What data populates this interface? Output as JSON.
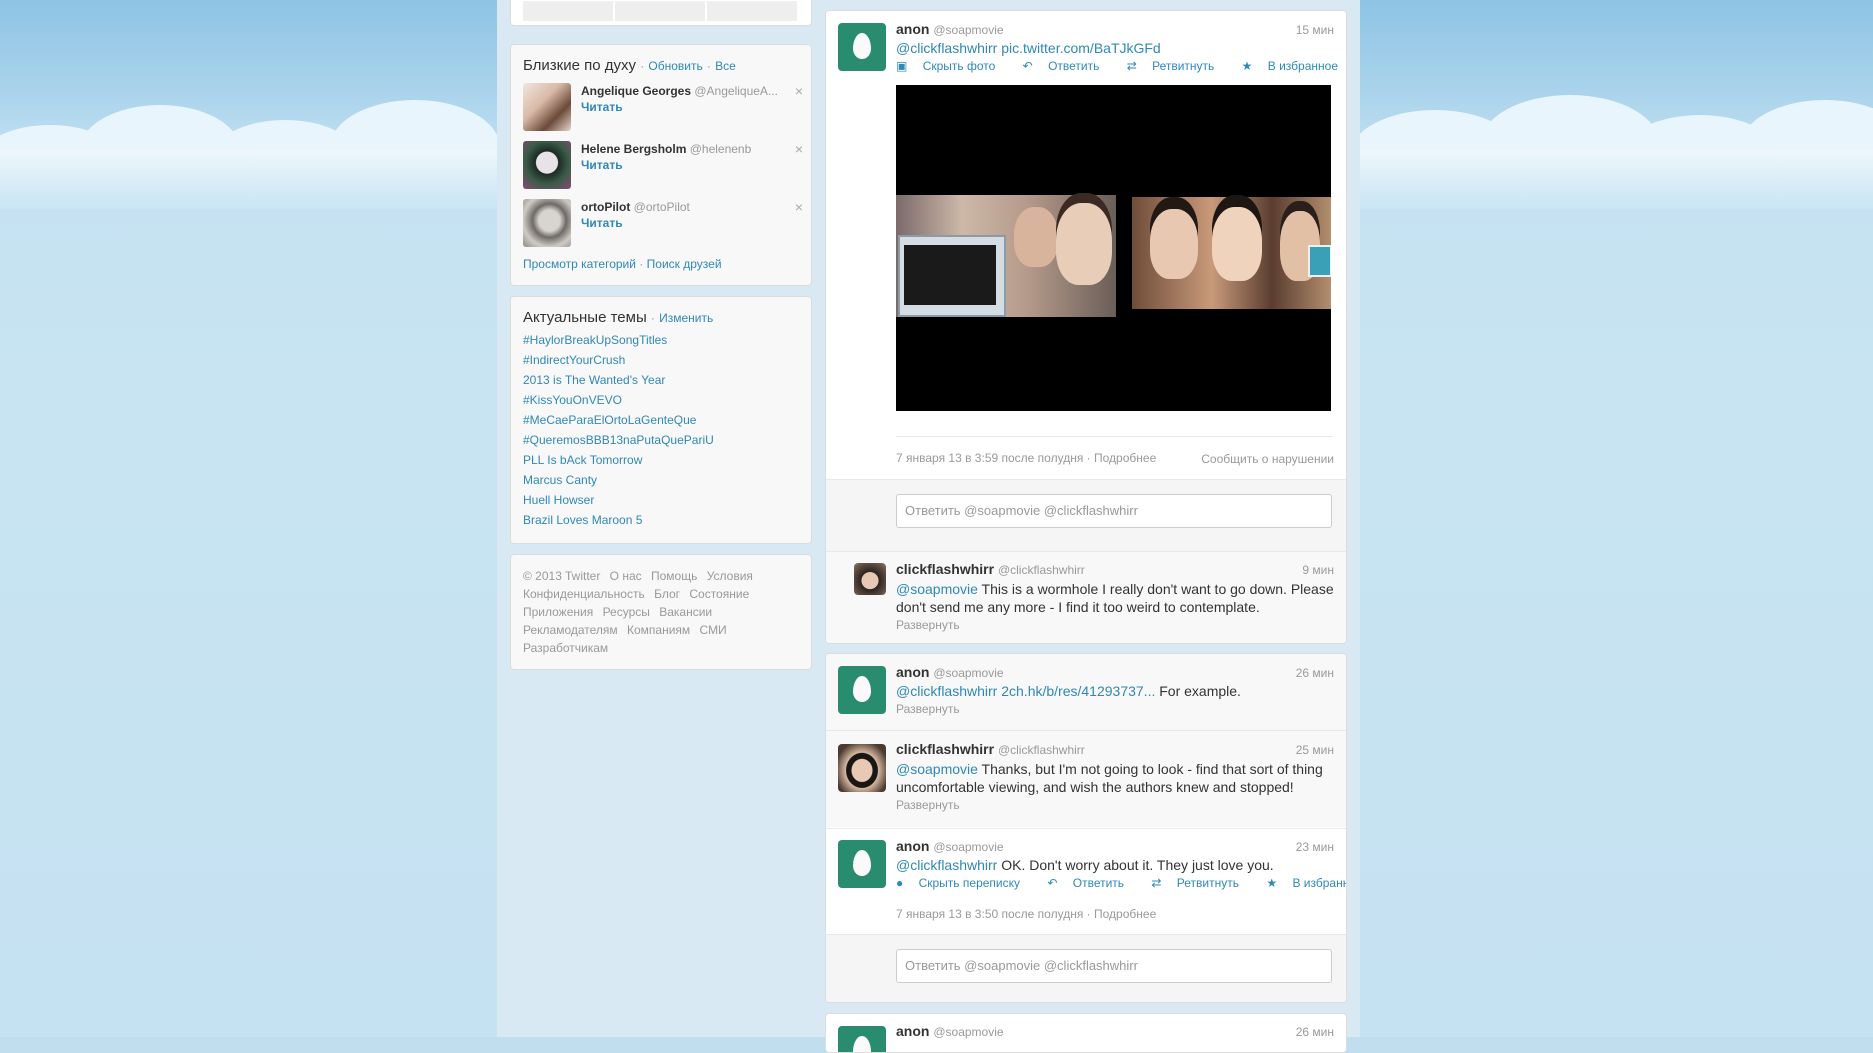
{
  "left": {
    "who_to_follow": {
      "title": "Близкие по духу",
      "refresh": "Обновить",
      "all": "Все",
      "sep": "·",
      "items": [
        {
          "name": "Angelique Georges",
          "handle": "@AngeliqueA...",
          "follow": "Читать"
        },
        {
          "name": "Helene Bergsholm",
          "handle": "@helenenb",
          "follow": "Читать"
        },
        {
          "name": "ortoPilot",
          "handle": "@ortoPilot",
          "follow": "Читать"
        }
      ],
      "close": "×",
      "browse": "Просмотр категорий",
      "find_friends": "Поиск друзей"
    },
    "trends": {
      "title": "Актуальные темы",
      "change": "Изменить",
      "items": [
        "#HaylorBreakUpSongTitles",
        "#IndirectYourCrush",
        "2013 is The Wanted's Year",
        "#KissYouOnVEVO",
        "#MeCaeParaElOrtoLaGenteQue",
        "#QueremosBBB13naPutaQuePariU",
        "PLL Is bAck Tomorrow",
        "Marcus Canty",
        "Huell Howser",
        "Brazil Loves Maroon 5"
      ]
    },
    "footer": {
      "links": [
        "© 2013 Twitter",
        "О нас",
        "Помощь",
        "Условия",
        "Конфиденциальность",
        "Блог",
        "Состояние",
        "Приложения",
        "Ресурсы",
        "Вакансии",
        "Рекламодателям",
        "Компаниям",
        "СМИ",
        "Разработчикам"
      ]
    }
  },
  "timeline": {
    "tweet1": {
      "name": "anon",
      "handle": "@soapmovie",
      "time": "15 мин",
      "mention": "@clickflashwhirr",
      "link": "pic.twitter.com/BaTJkGFd",
      "actions": {
        "hide_photo": "Скрыть фото",
        "reply": "Ответить",
        "retweet": "Ретвитнуть",
        "favorite": "В избранное"
      },
      "date": "7 января 13 в 3:59 после полудня",
      "details": "Подробнее",
      "report": "Сообщить о нарушении",
      "reply_placeholder": "Ответить @soapmovie @clickflashwhirr"
    },
    "reply1": {
      "name": "clickflashwhirr",
      "handle": "@clickflashwhirr",
      "time": "9 мин",
      "mention": "@soapmovie",
      "text": " This is a wormhole I really don't want to go down. Please don't send me any more - I find it too weird to contemplate.",
      "expand": "Развернуть"
    },
    "tweet2": {
      "name": "anon",
      "handle": "@soapmovie",
      "time": "26 мин",
      "mention": "@clickflashwhirr",
      "link": "2ch.hk/b/res/41293737...",
      "text": " For example.",
      "expand": "Развернуть"
    },
    "tweet3": {
      "name": "clickflashwhirr",
      "handle": "@clickflashwhirr",
      "time": "25 мин",
      "mention": "@soapmovie",
      "text": " Thanks, but I'm not going to look - find that sort of thing uncomfortable viewing, and wish the authors knew and stopped!",
      "expand": "Развернуть"
    },
    "tweet4": {
      "name": "anon",
      "handle": "@soapmovie",
      "time": "23 мин",
      "mention": "@clickflashwhirr",
      "text": " OK. Don't worry about it. They just love you.",
      "actions": {
        "hide_convo": "Скрыть переписку",
        "reply": "Ответить",
        "retweet": "Ретвитнуть",
        "favorite": "В избранное"
      },
      "date": "7 января 13 в 3:50 после полудня",
      "details": "Подробнее",
      "reply_placeholder": "Ответить @soapmovie @clickflashwhirr"
    },
    "tweet5": {
      "name": "anon",
      "handle": "@soapmovie",
      "time": "26 мин"
    }
  },
  "colors": {
    "link": "#2f88b5",
    "egg_bg": "#2a8c6e",
    "background": "#c0deed"
  }
}
